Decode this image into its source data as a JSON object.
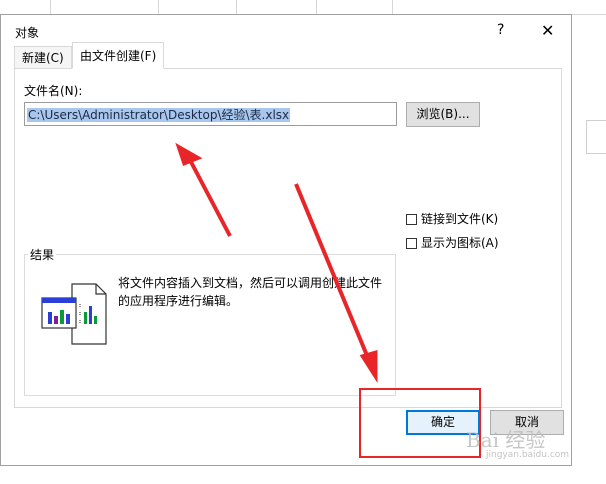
{
  "dialog": {
    "title": "对象",
    "help_label": "?",
    "close_label": "✕"
  },
  "tabs": [
    {
      "label": "新建(C)",
      "active": false
    },
    {
      "label": "由文件创建(F)",
      "active": true
    }
  ],
  "file": {
    "label": "文件名(N):",
    "value": "C:\\Users\\Administrator\\Desktop\\经验\\表.xlsx",
    "browse_label": "浏览(B)..."
  },
  "options": {
    "link_label": "链接到文件(K)",
    "icon_label": "显示为图标(A)",
    "link_checked": false,
    "icon_checked": false
  },
  "result": {
    "legend": "结果",
    "text": "将文件内容插入到文档，然后可以调用创建此文件的应用程序进行编辑。"
  },
  "buttons": {
    "ok_label": "确定",
    "cancel_label": "取消"
  },
  "watermark": {
    "text": "Bai 经验",
    "sub": "jingyan.baidu.com"
  },
  "colors": {
    "annotation": "#e8262a",
    "accent": "#0078d7",
    "selection": "#a9c6ec"
  },
  "icons": {
    "result": "document-chart-icon"
  }
}
